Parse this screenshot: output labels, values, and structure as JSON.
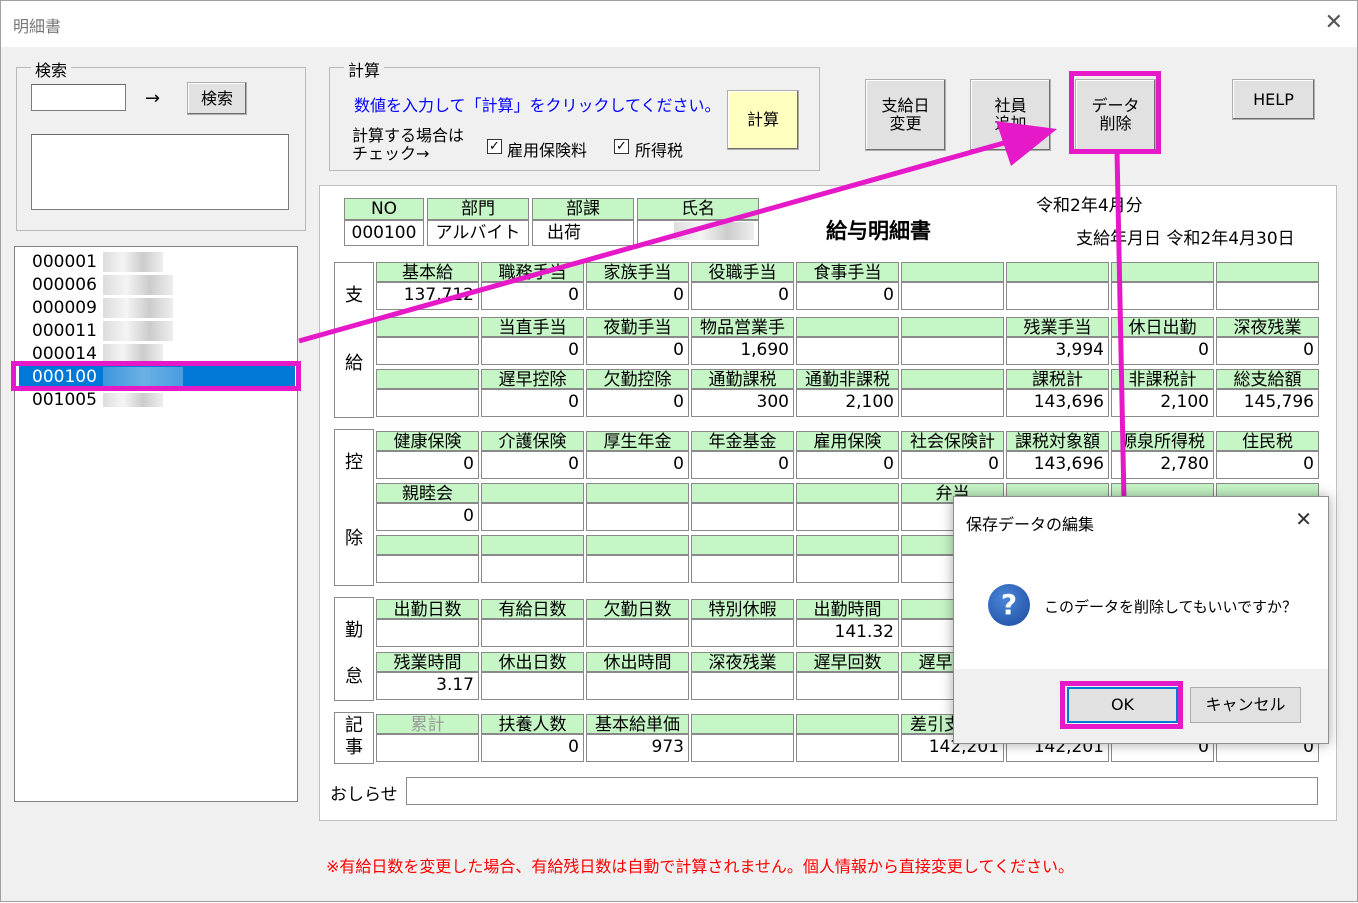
{
  "window": {
    "title": "明細書",
    "close": "✕"
  },
  "search": {
    "label": "検索",
    "arrow": "→",
    "button": "検索"
  },
  "calc": {
    "label": "計算",
    "instruction": "数値を入力して「計算」をクリックしてください。",
    "check_line1": "計算する場合は",
    "check_line2": "チェック→",
    "cb1": "雇用保険料",
    "cb2": "所得税",
    "button": "計算",
    "check_mark": "✓"
  },
  "toolbar": {
    "paydate_change": "支給日\n変更",
    "add_employee": "社員\n追加",
    "delete_data": "データ\n削除",
    "help": "HELP"
  },
  "employees": [
    {
      "id": "000001"
    },
    {
      "id": "000006"
    },
    {
      "id": "000009"
    },
    {
      "id": "000011"
    },
    {
      "id": "000014"
    },
    {
      "id": "000100"
    },
    {
      "id": "001005"
    }
  ],
  "sheet": {
    "hdr": {
      "no_label": "NO",
      "dept_label": "部門",
      "section_label": "部課",
      "name_label": "氏名",
      "no": "000100",
      "dept": "アルバイト",
      "section": "出荷"
    },
    "title": "給与明細書",
    "period": "令和2年4月分",
    "paydate": "支給年月日 令和2年4月30日",
    "sec_pay": [
      "支",
      "給"
    ],
    "sec_ded": [
      "控",
      "除"
    ],
    "sec_att": [
      "勤",
      "怠"
    ],
    "sec_note": [
      "記",
      "事"
    ],
    "pay": {
      "r1h": [
        "基本給",
        "職務手当",
        "家族手当",
        "役職手当",
        "食事手当",
        "",
        "",
        "",
        ""
      ],
      "r1v": [
        "137,712",
        "0",
        "0",
        "0",
        "0",
        "",
        "",
        "",
        ""
      ],
      "r2h": [
        "",
        "当直手当",
        "夜勤手当",
        "物品営業手",
        "",
        "",
        "残業手当",
        "休日出勤",
        "深夜残業"
      ],
      "r2v": [
        "",
        "0",
        "0",
        "1,690",
        "",
        "",
        "3,994",
        "0",
        "0"
      ],
      "r3h": [
        "",
        "遅早控除",
        "欠勤控除",
        "通勤課税",
        "通勤非課税",
        "",
        "課税計",
        "非課税計",
        "総支給額"
      ],
      "r3v": [
        "",
        "0",
        "0",
        "300",
        "2,100",
        "",
        "143,696",
        "2,100",
        "145,796"
      ]
    },
    "ded": {
      "r1h": [
        "健康保険",
        "介護保険",
        "厚生年金",
        "年金基金",
        "雇用保険",
        "社会保険計",
        "課税対象額",
        "源泉所得税",
        "住民税"
      ],
      "r1v": [
        "0",
        "0",
        "0",
        "0",
        "0",
        "0",
        "143,696",
        "2,780",
        "0"
      ],
      "r2h": [
        "親睦会",
        "",
        "",
        "",
        "",
        "弁当",
        "",
        "",
        ""
      ],
      "r2v": [
        "0",
        "",
        "",
        "",
        "",
        "",
        "",
        "",
        ""
      ]
    },
    "att": {
      "r1h": [
        "出勤日数",
        "有給日数",
        "欠勤日数",
        "特別休暇",
        "出勤時間",
        "",
        "",
        "",
        ""
      ],
      "r1v": [
        "",
        "",
        "",
        "",
        "141.32",
        "",
        "",
        "",
        ""
      ],
      "r2h": [
        "残業時間",
        "休出日数",
        "休出時間",
        "深夜残業",
        "遅早回数",
        "遅早時間",
        "",
        "",
        ""
      ],
      "r2v": [
        "3.17",
        "",
        "",
        "",
        "",
        "",
        "",
        "",
        ""
      ]
    },
    "note": {
      "h": [
        "累計",
        "扶養人数",
        "基本給単価",
        "",
        "",
        "差引支給額",
        "",
        "",
        ""
      ],
      "v": [
        "",
        "0",
        "973",
        "",
        "",
        "142,201",
        "142,201",
        "0",
        "0"
      ]
    },
    "notice_label": "おしらせ"
  },
  "warning": "※有給日数を変更した場合、有給残日数は自動で計算されません。個人情報から直接変更してください。",
  "dialog": {
    "title": "保存データの編集",
    "close": "✕",
    "icon": "?",
    "message": "このデータを削除してもいいですか？",
    "ok": "OK",
    "cancel": "キャンセル"
  },
  "colors": {
    "header_green": "#c6f5c6",
    "highlight": "#e619c9",
    "selection": "#0078d7",
    "warning": "#ff0000",
    "instruction": "#0000ff"
  }
}
